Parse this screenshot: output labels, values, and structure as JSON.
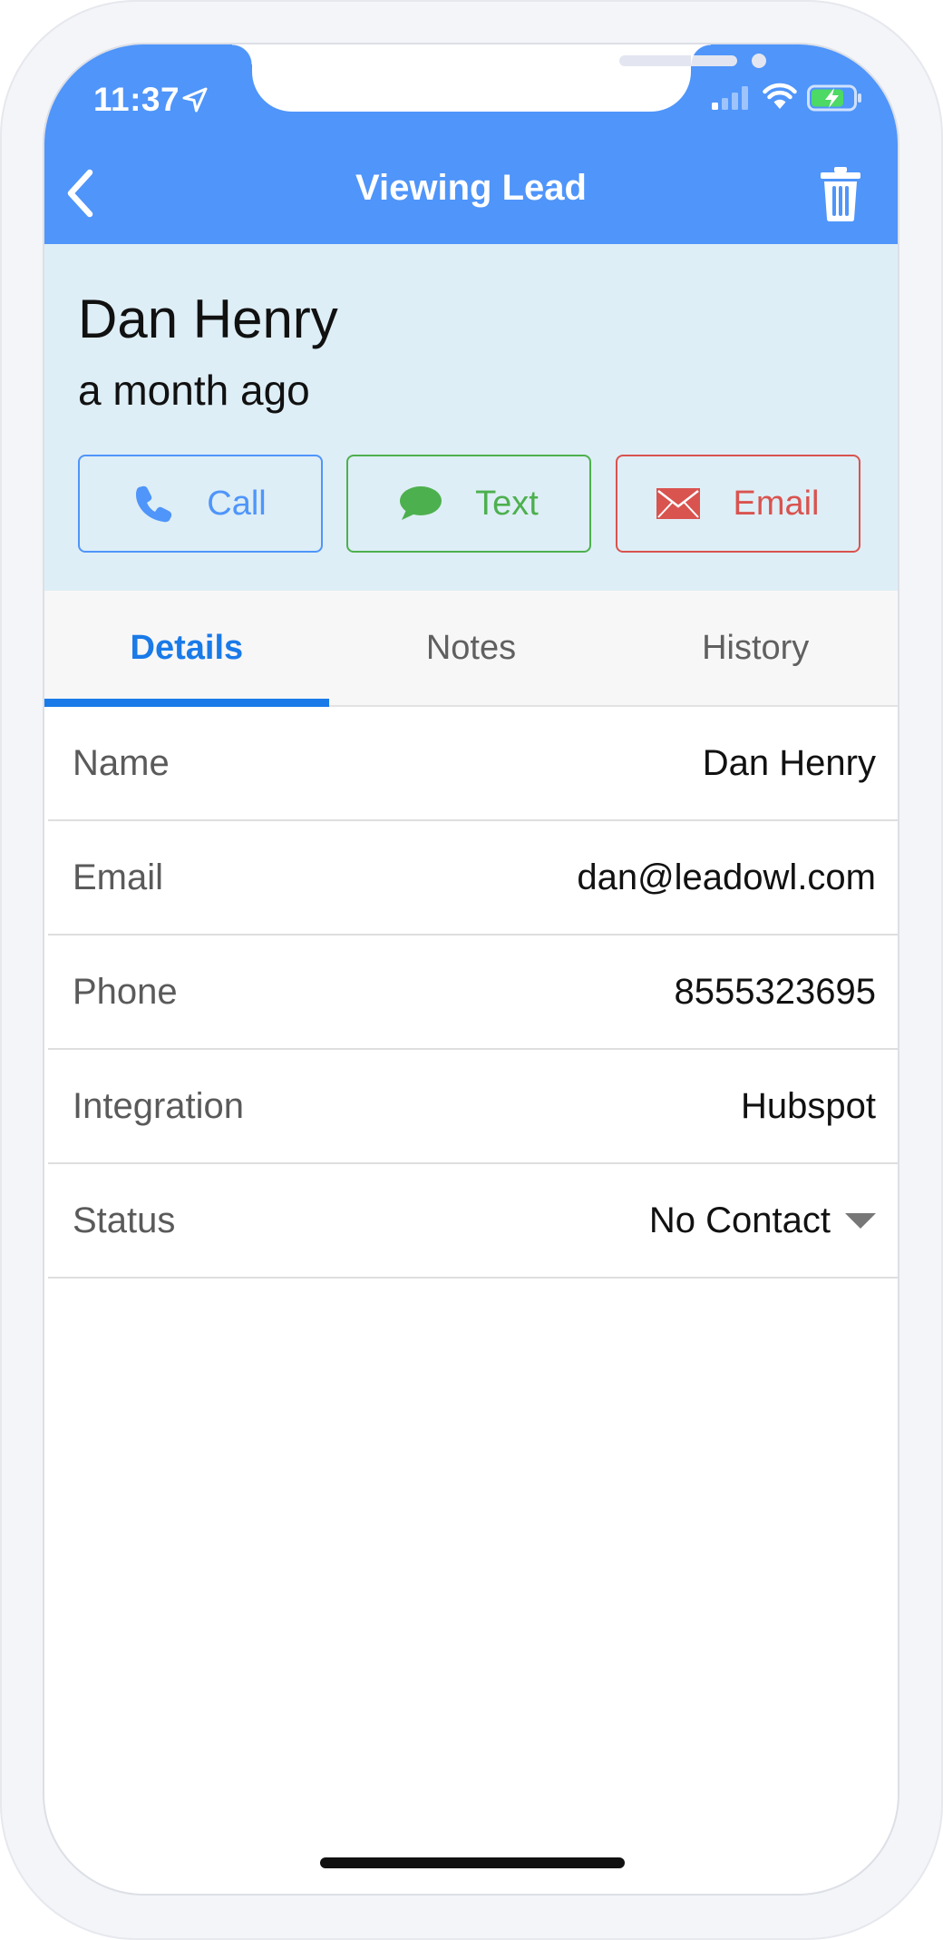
{
  "status_bar": {
    "time": "11:37"
  },
  "nav": {
    "title": "Viewing Lead"
  },
  "lead": {
    "name": "Dan Henry",
    "created_relative": "a month ago"
  },
  "actions": {
    "call_label": "Call",
    "text_label": "Text",
    "email_label": "Email"
  },
  "tabs": [
    {
      "label": "Details",
      "active": true
    },
    {
      "label": "Notes",
      "active": false
    },
    {
      "label": "History",
      "active": false
    }
  ],
  "details": [
    {
      "label": "Name",
      "value": "Dan Henry"
    },
    {
      "label": "Email",
      "value": "dan@leadowl.com"
    },
    {
      "label": "Phone",
      "value": "8555323695"
    },
    {
      "label": "Integration",
      "value": "Hubspot"
    },
    {
      "label": "Status",
      "value": "No Contact"
    }
  ],
  "colors": {
    "nav_blue": "#4f95fa",
    "header_bg": "#deeef6",
    "call": "#4f95fa",
    "text": "#4db04e",
    "email": "#d9534f",
    "tab_active": "#1a7ae8"
  },
  "icons": {
    "back": "chevron-left-icon",
    "delete": "trash-icon",
    "call": "phone-icon",
    "text": "chat-bubble-icon",
    "email": "envelope-icon",
    "status_dropdown": "caret-down-icon"
  }
}
